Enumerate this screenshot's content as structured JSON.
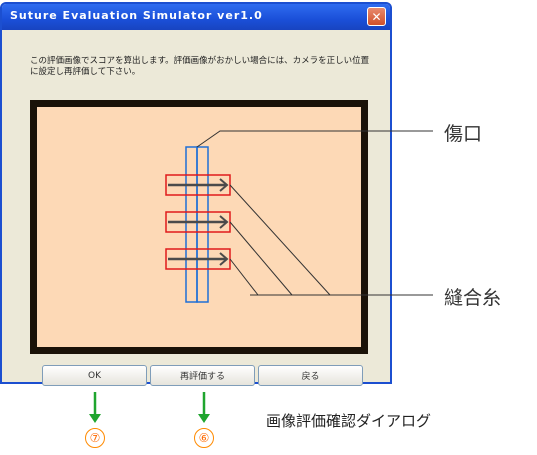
{
  "window": {
    "title": "Suture Evaluation Simulator ver1.0",
    "close_glyph": "✕",
    "message": "この評価画像でスコアを算出します。評価画像がおかしい場合には、カメラを正しい位置に設定し再評価して下さい。"
  },
  "buttons": {
    "ok": "OK",
    "reevaluate": "再評価する",
    "back": "戻る"
  },
  "annotations": {
    "wound": "傷口",
    "suture_thread": "縫合糸",
    "caption": "画像評価確認ダイアログ",
    "marker_ok": "⑦",
    "marker_reevaluate": "⑥"
  },
  "colors": {
    "title_bar": "#1a4fd8",
    "panel_background": "#fdd9b6",
    "wound_box": "#1f6fd6",
    "suture_box": "#e01b1b",
    "arrow": "#1fa52e"
  }
}
